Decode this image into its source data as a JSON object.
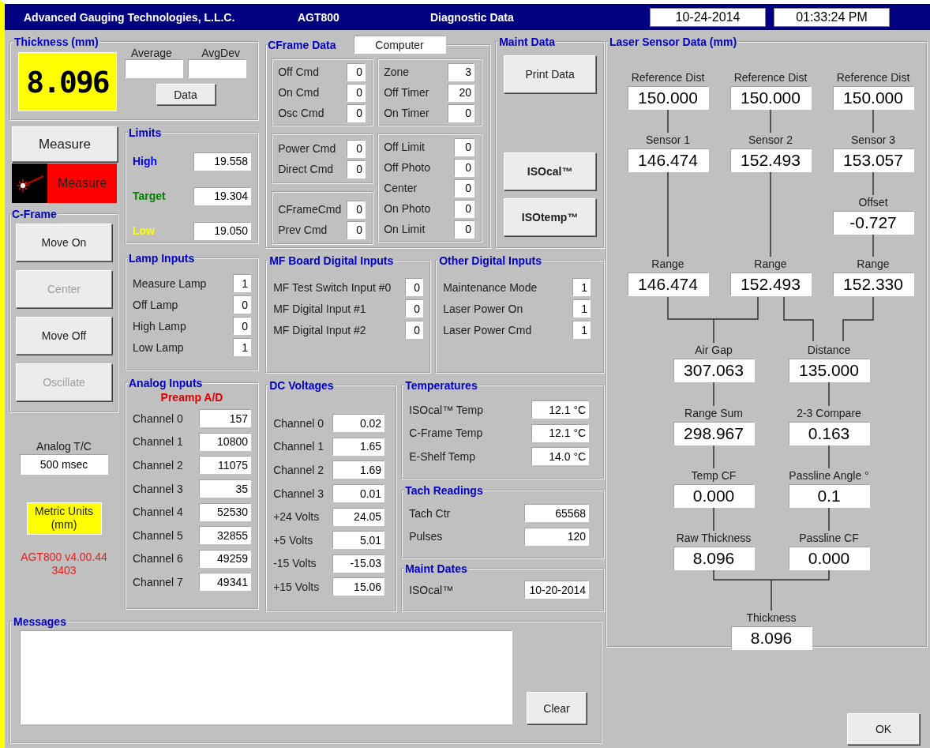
{
  "title_bar": {
    "company": "Advanced Gauging Technologies, L.L.C.",
    "model": "AGT800",
    "title": "Diagnostic Data",
    "date": "10-24-2014",
    "time": "01:33:24 PM"
  },
  "thickness": {
    "title": "Thickness (mm)",
    "value": "8.096",
    "average_label": "Average",
    "avgdev_label": "AvgDev",
    "data_button": "Data"
  },
  "measure_button": "Measure",
  "laser_status": "Measure",
  "cframe": {
    "title": "C-Frame",
    "buttons": [
      {
        "label": "Move On",
        "disabled": false
      },
      {
        "label": "Center",
        "disabled": true
      },
      {
        "label": "Move Off",
        "disabled": false
      },
      {
        "label": "Oscillate",
        "disabled": true
      }
    ]
  },
  "analog_tc": {
    "label": "Analog T/C",
    "value": "500 msec"
  },
  "units": "Metric Units (mm)",
  "version": "AGT800 v4.00.44 3403",
  "limits": {
    "title": "Limits",
    "rows": [
      {
        "label": "High",
        "value": "19.558",
        "color": "#0000ff"
      },
      {
        "label": "Target",
        "value": "19.304",
        "color": "#008000"
      },
      {
        "label": "Low",
        "value": "19.050",
        "color": "#ffff00"
      }
    ]
  },
  "lamp_inputs": {
    "title": "Lamp Inputs",
    "rows": [
      {
        "label": "Measure Lamp",
        "value": "1"
      },
      {
        "label": "Off Lamp",
        "value": "0"
      },
      {
        "label": "High Lamp",
        "value": "0"
      },
      {
        "label": "Low Lamp",
        "value": "1"
      }
    ]
  },
  "analog_inputs": {
    "title": "Analog Inputs",
    "subtitle": "Preamp A/D",
    "rows": [
      {
        "label": "Channel 0",
        "value": "157"
      },
      {
        "label": "Channel 1",
        "value": "10800"
      },
      {
        "label": "Channel 2",
        "value": "11075"
      },
      {
        "label": "Channel 3",
        "value": "35"
      },
      {
        "label": "Channel 4",
        "value": "52530"
      },
      {
        "label": "Channel 5",
        "value": "32855"
      },
      {
        "label": "Channel 6",
        "value": "49259"
      },
      {
        "label": "Channel 7",
        "value": "49341"
      }
    ]
  },
  "cframe_data": {
    "title": "CFrame Data",
    "source": "Computer",
    "left_groups": [
      [
        {
          "label": "Off Cmd",
          "value": "0"
        },
        {
          "label": "On Cmd",
          "value": "0"
        },
        {
          "label": "Osc Cmd",
          "value": "0"
        }
      ],
      [
        {
          "label": "Power Cmd",
          "value": "0"
        },
        {
          "label": "Direct Cmd",
          "value": "0"
        }
      ],
      [
        {
          "label": "CFrameCmd",
          "value": "0"
        },
        {
          "label": "Prev Cmd",
          "value": "0"
        }
      ]
    ],
    "right_groups": [
      [
        {
          "label": "Zone",
          "value": "3"
        },
        {
          "label": "Off Timer",
          "value": "20"
        },
        {
          "label": "On Timer",
          "value": "0"
        }
      ],
      [
        {
          "label": "Off Limit",
          "value": "0"
        },
        {
          "label": "Off Photo",
          "value": "0"
        },
        {
          "label": "Center",
          "value": "0"
        },
        {
          "label": "On Photo",
          "value": "0"
        },
        {
          "label": "On Limit",
          "value": "0"
        }
      ]
    ]
  },
  "maint_data": {
    "title": "Maint Data",
    "print_button": "Print Data",
    "isocal_button": "ISOcal™",
    "isotemp_button": "ISOtemp™"
  },
  "mf_inputs": {
    "title": "MF Board Digital Inputs",
    "rows": [
      {
        "label": "MF Test Switch Input #0",
        "value": "0"
      },
      {
        "label": "MF Digital Input #1",
        "value": "0"
      },
      {
        "label": "MF Digital Input #2",
        "value": "0"
      }
    ]
  },
  "other_inputs": {
    "title": "Other Digital Inputs",
    "rows": [
      {
        "label": "Maintenance Mode",
        "value": "1"
      },
      {
        "label": "Laser Power On",
        "value": "1"
      },
      {
        "label": "Laser Power Cmd",
        "value": "1"
      }
    ]
  },
  "dc_voltages": {
    "title": "DC Voltages",
    "rows": [
      {
        "label": "Channel 0",
        "value": "0.02"
      },
      {
        "label": "Channel 1",
        "value": "1.65"
      },
      {
        "label": "Channel 2",
        "value": "1.69"
      },
      {
        "label": "Channel 3",
        "value": "0.01"
      },
      {
        "label": "+24 Volts",
        "value": "24.05"
      },
      {
        "label": "+5 Volts",
        "value": "5.01"
      },
      {
        "label": "-15 Volts",
        "value": "-15.03"
      },
      {
        "label": "+15 Volts",
        "value": "15.06"
      }
    ]
  },
  "temperatures": {
    "title": "Temperatures",
    "rows": [
      {
        "label": "ISOcal™ Temp",
        "value": "12.1 °C"
      },
      {
        "label": "C-Frame Temp",
        "value": "12.1 °C"
      },
      {
        "label": "E-Shelf Temp",
        "value": "14.0 °C"
      }
    ]
  },
  "tach_readings": {
    "title": "Tach Readings",
    "rows": [
      {
        "label": "Tach Ctr",
        "value": "65568"
      },
      {
        "label": "Pulses",
        "value": "120"
      }
    ]
  },
  "maint_dates": {
    "title": "Maint Dates",
    "rows": [
      {
        "label": "ISOcal™",
        "value": "10-20-2014"
      }
    ]
  },
  "messages": {
    "title": "Messages",
    "clear_button": "Clear"
  },
  "laser_sensor": {
    "title": "Laser Sensor Data (mm)",
    "nodes": [
      {
        "label": "Reference Dist",
        "value": "150.000"
      },
      {
        "label": "Reference Dist",
        "value": "150.000"
      },
      {
        "label": "Reference Dist",
        "value": "150.000"
      },
      {
        "label": "Sensor 1",
        "value": "146.474"
      },
      {
        "label": "Sensor 2",
        "value": "152.493"
      },
      {
        "label": "Sensor 3",
        "value": "153.057"
      },
      {
        "label": "Offset",
        "value": "-0.727"
      },
      {
        "label": "Range",
        "value": "146.474"
      },
      {
        "label": "Range",
        "value": "152.493"
      },
      {
        "label": "Range",
        "value": "152.330"
      },
      {
        "label": "Air Gap",
        "value": "307.063"
      },
      {
        "label": "Distance",
        "value": "135.000"
      },
      {
        "label": "Range Sum",
        "value": "298.967"
      },
      {
        "label": "2-3 Compare",
        "value": "0.163"
      },
      {
        "label": "Temp CF",
        "value": "0.000"
      },
      {
        "label": "Passline Angle °",
        "value": "0.1"
      },
      {
        "label": "Raw Thickness",
        "value": "8.096"
      },
      {
        "label": "Passline CF",
        "value": "0.000"
      },
      {
        "label": "Thickness",
        "value": "8.096"
      }
    ]
  },
  "ok_button": "OK"
}
